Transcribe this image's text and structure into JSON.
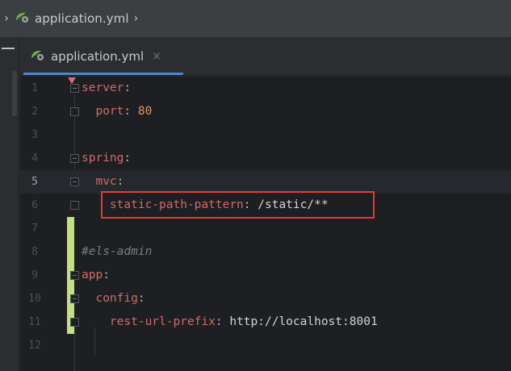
{
  "breadcrumb": {
    "file": "application.yml"
  },
  "tab": {
    "label": "application.yml",
    "close": "×"
  },
  "editor": {
    "lines": [
      {
        "num": "1",
        "tokens": [
          {
            "t": "server",
            "c": "k"
          },
          {
            "t": ":",
            "c": "p"
          }
        ]
      },
      {
        "num": "2",
        "tokens": [
          {
            "t": "  port",
            "c": "k"
          },
          {
            "t": ": ",
            "c": "p"
          },
          {
            "t": "80",
            "c": "num"
          }
        ]
      },
      {
        "num": "3",
        "tokens": []
      },
      {
        "num": "4",
        "tokens": [
          {
            "t": "spring",
            "c": "k"
          },
          {
            "t": ":",
            "c": "p"
          }
        ]
      },
      {
        "num": "5",
        "tokens": [
          {
            "t": "  mvc",
            "c": "k"
          },
          {
            "t": ":",
            "c": "p"
          }
        ]
      },
      {
        "num": "6",
        "tokens": [
          {
            "t": "    static-path-pattern",
            "c": "k"
          },
          {
            "t": ": ",
            "c": "p"
          },
          {
            "t": "/static/**",
            "c": "v"
          }
        ]
      },
      {
        "num": "7",
        "tokens": []
      },
      {
        "num": "8",
        "tokens": [
          {
            "t": "#els-admin",
            "c": "cmt"
          }
        ]
      },
      {
        "num": "9",
        "tokens": [
          {
            "t": "app",
            "c": "k"
          },
          {
            "t": ":",
            "c": "p"
          }
        ]
      },
      {
        "num": "10",
        "tokens": [
          {
            "t": "  config",
            "c": "k"
          },
          {
            "t": ":",
            "c": "p"
          }
        ]
      },
      {
        "num": "11",
        "tokens": [
          {
            "t": "    rest-url-prefix",
            "c": "k"
          },
          {
            "t": ": ",
            "c": "p"
          },
          {
            "t": "http://localhost:8001",
            "c": "v"
          }
        ]
      },
      {
        "num": "12",
        "tokens": []
      }
    ],
    "current_line": "5"
  },
  "colors": {
    "key": "#cf6b6b",
    "number": "#e3936b",
    "comment": "#7a7e85",
    "highlight_box": "#e53935",
    "vcs_added": "#bfe17f",
    "tab_underline": "#4a88c7"
  },
  "icons": {
    "breadcrumb_file": "spring-yaml-file-icon",
    "tab_file": "spring-yaml-file-icon",
    "tab_close": "close-icon"
  }
}
